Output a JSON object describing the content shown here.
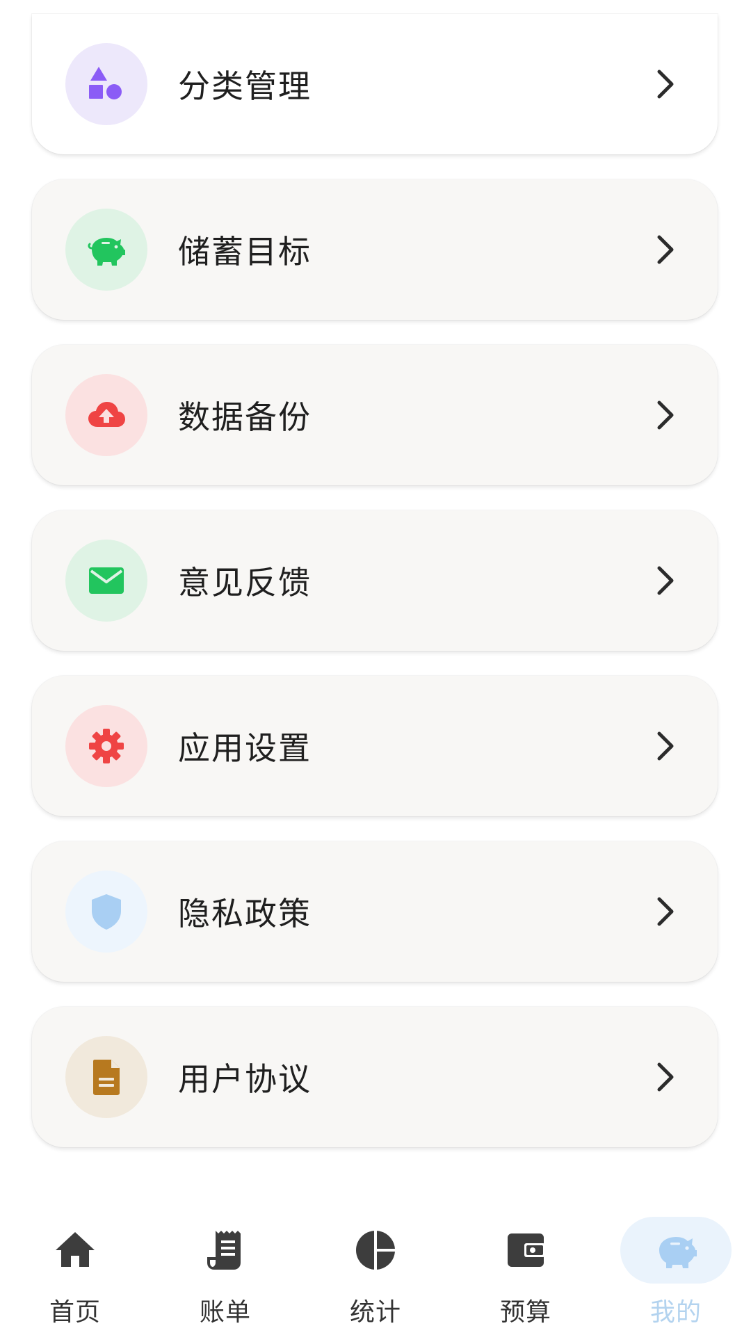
{
  "menu": {
    "items": [
      {
        "label": "分类管理",
        "icon": "shapes-icon",
        "icon_color": "#8b5cf6",
        "bg_color": "#ede8fb"
      },
      {
        "label": "储蓄目标",
        "icon": "piggy-bank-icon",
        "icon_color": "#22c55e",
        "bg_color": "#dff3e5"
      },
      {
        "label": "数据备份",
        "icon": "cloud-upload-icon",
        "icon_color": "#ef4444",
        "bg_color": "#fbe1e1"
      },
      {
        "label": "意见反馈",
        "icon": "envelope-icon",
        "icon_color": "#22c55e",
        "bg_color": "#dff3e5"
      },
      {
        "label": "应用设置",
        "icon": "gear-icon",
        "icon_color": "#ef4444",
        "bg_color": "#fbe1e1"
      },
      {
        "label": "隐私政策",
        "icon": "shield-icon",
        "icon_color": "#a9cff3",
        "bg_color": "#edf5fd"
      },
      {
        "label": "用户协议",
        "icon": "document-icon",
        "icon_color": "#b7791f",
        "bg_color": "#f1e9dc"
      }
    ]
  },
  "bottom_nav": {
    "items": [
      {
        "label": "首页",
        "icon": "home-icon"
      },
      {
        "label": "账单",
        "icon": "receipt-icon"
      },
      {
        "label": "统计",
        "icon": "pie-chart-icon"
      },
      {
        "label": "预算",
        "icon": "wallet-icon"
      },
      {
        "label": "我的",
        "icon": "piggy-bank-icon",
        "active": true
      }
    ],
    "inactive_color": "#3d3d3d",
    "active_color": "#b3d3ef",
    "active_bg": "#eaf3fc"
  }
}
